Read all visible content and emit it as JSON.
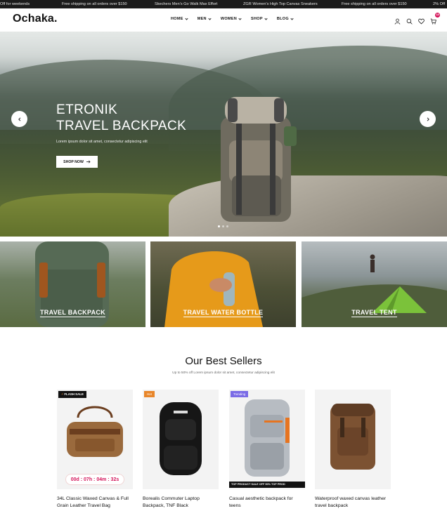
{
  "announcement": {
    "messages": [
      "Off for weekends",
      "Free shipping on all orders over $150",
      "Skechers Men's Go Walk Max Effort",
      "ZGR Women's High Top Canvas Sneakers",
      "Free shipping on all orders over $150",
      "2% Off"
    ]
  },
  "header": {
    "logo": "Ochaka.",
    "nav": [
      {
        "label": "HOME"
      },
      {
        "label": "MEN"
      },
      {
        "label": "WOMEN"
      },
      {
        "label": "SHOP"
      },
      {
        "label": "BLOG"
      }
    ],
    "icons": [
      "user-icon",
      "search-icon",
      "heart-icon",
      "cart-icon"
    ],
    "cart_count": "18"
  },
  "hero": {
    "title_line1": "ETRONIK",
    "title_line2": "TRAVEL BACKPACK",
    "subtitle": "Lorem ipsum dolor sit amet, consectetur adipiscing elit",
    "cta": "SHOP NOW",
    "cta_icon": "arrow-right-icon",
    "prev_icon": "chevron-left-icon",
    "next_icon": "chevron-right-icon"
  },
  "categories": [
    {
      "label": "TRAVEL BACKPACK"
    },
    {
      "label": "TRAVEL WATER BOTTLE"
    },
    {
      "label": "TRAVEL TENT"
    }
  ],
  "best_sellers": {
    "title": "Our Best Sellers",
    "subtitle": "Up to 50% off Lorem ipsum dolor sit amet, consectetur adipiscing elit",
    "products": [
      {
        "name": "34L Classic Waxed Canvas & Full Grain Leather Travel Bag",
        "badge": "FLASH SALE",
        "countdown": "00d : 07h : 04m : 32s"
      },
      {
        "name": "Borealis Commuter Laptop Backpack, TNF Black",
        "badge": "Hot"
      },
      {
        "name": "Casual aesthetic backpack for teens",
        "badge": "Trending",
        "promo": "TOP PRODUCT SALE OFF 50%   TOP PROD"
      },
      {
        "name": "Waterproof waxed canvas leather travel backpack"
      }
    ]
  },
  "colors": {
    "topbar": "#1b1b1b",
    "accent": "#d4145a",
    "hot_badge": "#e8862a",
    "trending_badge": "#7a6be6"
  }
}
